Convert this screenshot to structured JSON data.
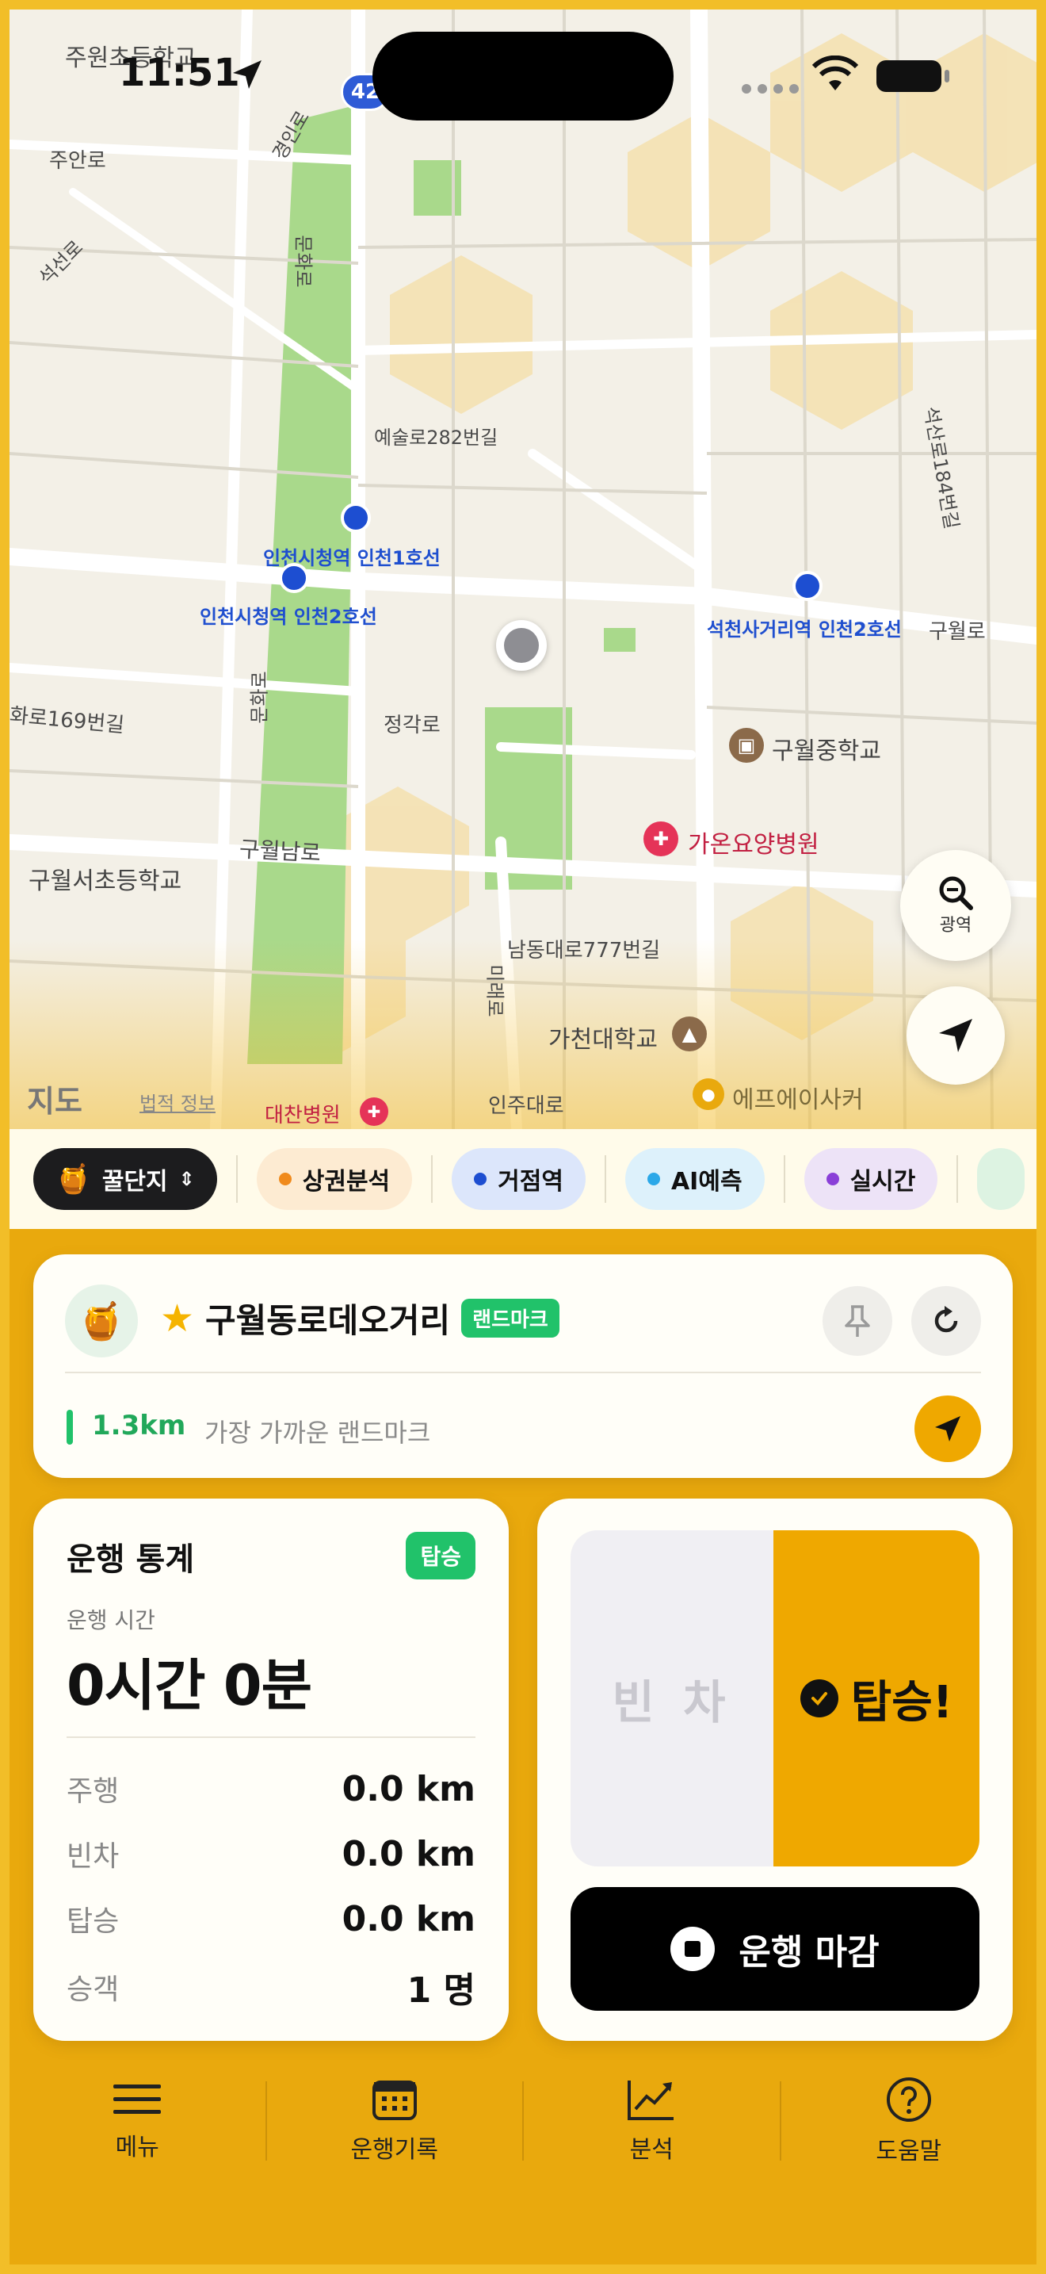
{
  "status_bar": {
    "time": "11:51"
  },
  "map": {
    "route_shield": "42",
    "labels": {
      "juwon_school": "주원초등학교",
      "juan_ro": "주안로",
      "gyeongin_ro": "경인로",
      "seokseon_ro": "석선로",
      "gyeongin_ro2": "경인로",
      "munhwa_ro": "문화로",
      "yesul_ro": "예술로282번길",
      "seokseon_ro184": "석산로184번길",
      "station1": "인천시청역 인천1호선",
      "station2": "인천시청역 인천2호선",
      "station3": "석천사거리역 인천2호선",
      "guwol_ro": "구월로",
      "hwa_ro169": "화로169번길",
      "munhwa_ro2": "문화로",
      "jeonggak_ro": "정각로",
      "guwol_middle": "구월중학교",
      "gaon_hospital": "가온요양병원",
      "guwolnam_ro": "구월남로",
      "guwol_seo_school": "구월서초등학교",
      "namdong_777": "남동대로777번길",
      "mirae_ro": "미래로",
      "gachon_univ": "가천대학교",
      "injudaero": "인주대로",
      "daechan_hospital": "대찬병원",
      "fa_academy": "에프에이사커",
      "apple_maps": "지도",
      "legal_info": "법적 정보"
    },
    "zoom_button_label": "광역"
  },
  "filters": [
    {
      "label": "꿀단지",
      "color": "#111111"
    },
    {
      "label": "상권분석",
      "color": "#F08A1C"
    },
    {
      "label": "거점역",
      "color": "#1D4ED1"
    },
    {
      "label": "AI예측",
      "color": "#2BA8E8"
    },
    {
      "label": "실시간",
      "color": "#8A3FD8"
    }
  ],
  "landmark_card": {
    "title": "구월동로데오거리",
    "badge": "랜드마크",
    "distance": "1.3km",
    "subtitle": "가장 가까운 랜드마크"
  },
  "stats": {
    "title": "운행 통계",
    "badge": "탑승",
    "duration_label": "운행 시간",
    "duration": "0시간 0분",
    "rows": [
      {
        "label": "주행",
        "value": "0.0 km"
      },
      {
        "label": "빈차",
        "value": "0.0 km"
      },
      {
        "label": "탑승",
        "value": "0.0 km"
      },
      {
        "label": "승객",
        "value": "1 명"
      }
    ]
  },
  "toggle": {
    "empty_label": "빈 차",
    "ride_label": "탑승!",
    "end_button": "운행 마감"
  },
  "tabbar": [
    {
      "label": "메뉴",
      "icon": "menu-icon"
    },
    {
      "label": "운행기록",
      "icon": "calendar-icon"
    },
    {
      "label": "분석",
      "icon": "chart-icon"
    },
    {
      "label": "도움말",
      "icon": "help-icon"
    }
  ],
  "colors": {
    "accent": "#EFA800",
    "green": "#21C26A",
    "station_blue": "#1D4ED1"
  }
}
